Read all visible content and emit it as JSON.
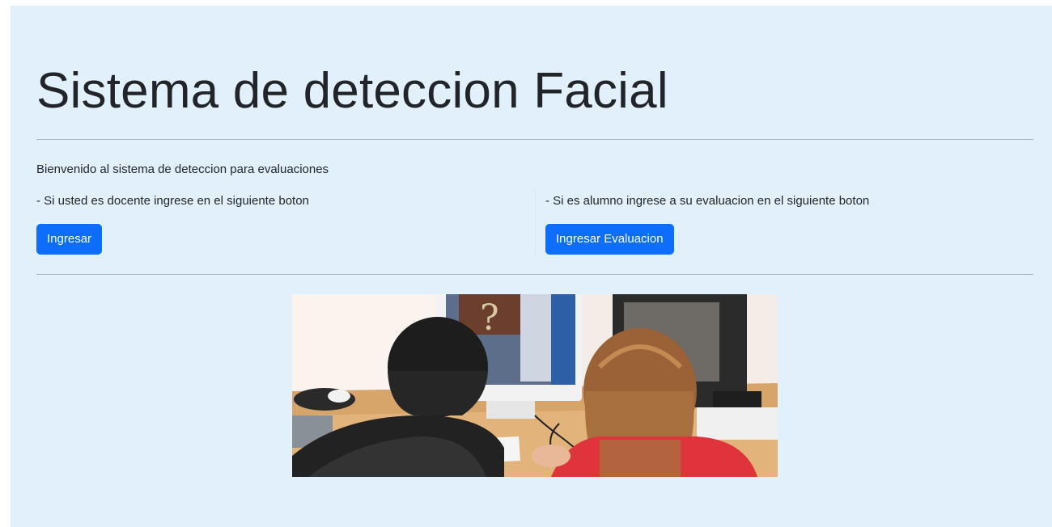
{
  "header": {
    "title": "Sistema de deteccion Facial"
  },
  "intro": {
    "welcome_text": "Bienvenido al sistema de deteccion para evaluaciones"
  },
  "teacher": {
    "text": "- Si usted es docente ingrese en el siguiente boton",
    "button_label": "Ingresar"
  },
  "student": {
    "text": "- Si es alumno ingrese a su evaluacion en el siguiente boton",
    "button_label": "Ingresar Evaluacion"
  },
  "colors": {
    "background": "#e2f0fc",
    "primary_button": "#0d6efd",
    "text": "#212529"
  },
  "image": {
    "description_icon": "students-at-computer-photo"
  }
}
